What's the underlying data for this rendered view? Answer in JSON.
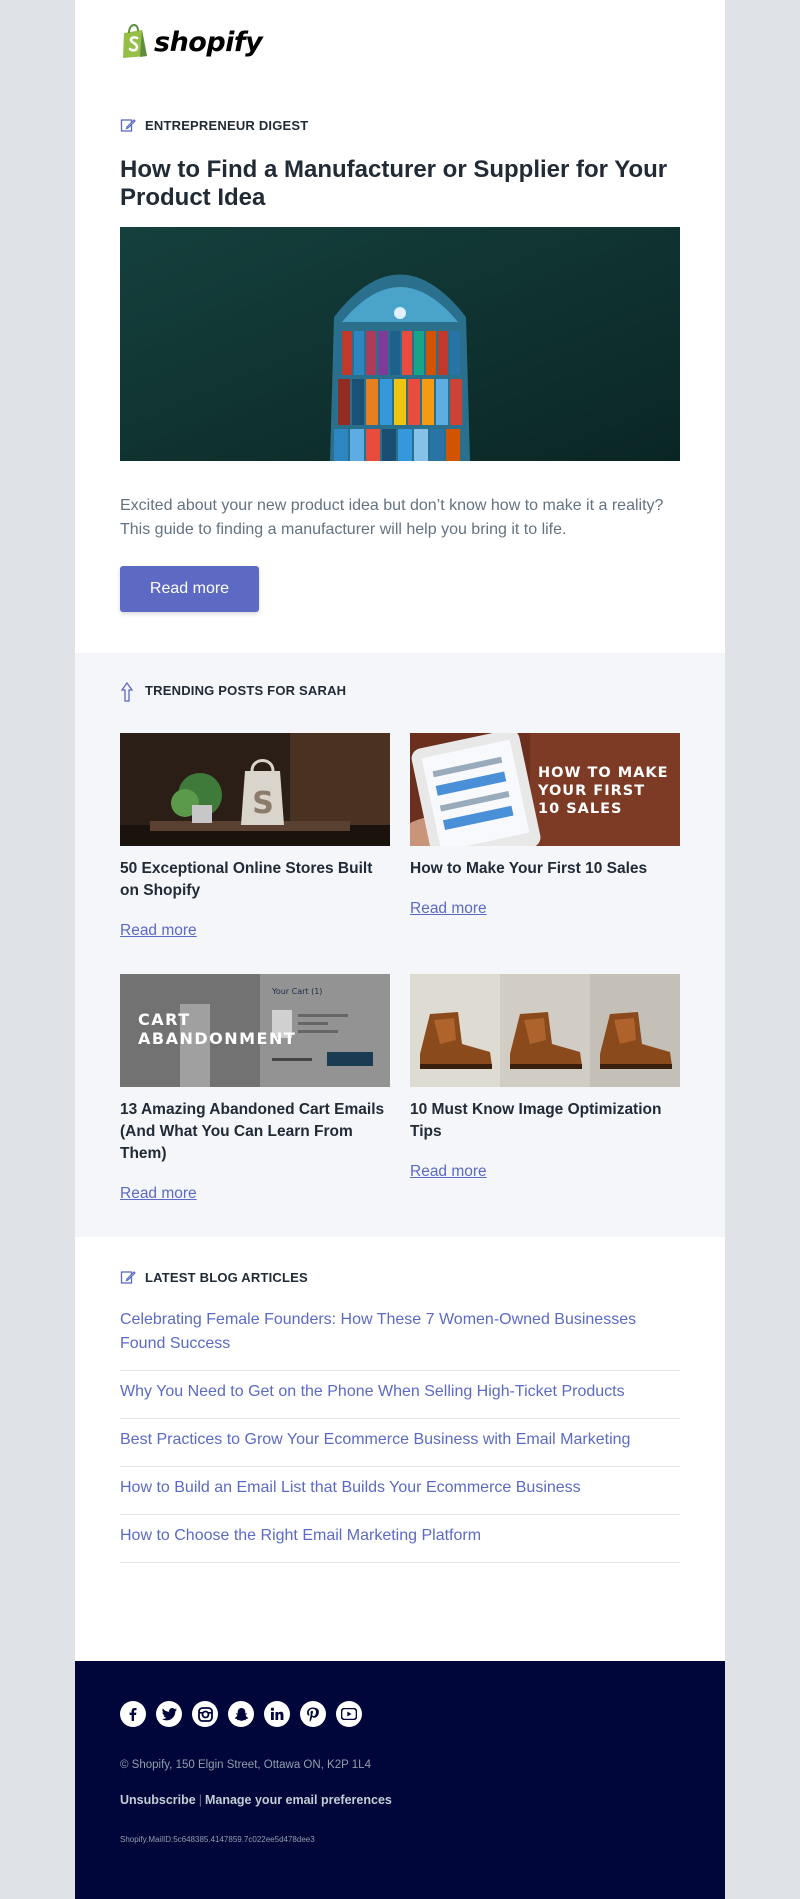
{
  "brand": {
    "wordmark": "shopify",
    "logo_icon": "shopify-bag-icon",
    "accent": "#5c6ac4",
    "logo_green": "#95bf47"
  },
  "hero": {
    "section_label": "ENTREPRENEUR DIGEST",
    "section_icon": "edit-note-icon",
    "title": "How to Find a Manufacturer or Supplier for Your Product Idea",
    "image": "cargo-ship-aerial-image",
    "body": "Excited about your new product idea but don’t know how to make it a reality? This guide to finding a manufacturer will help you bring it to life.",
    "button_label": "Read more"
  },
  "trending": {
    "section_label": "TRENDING POSTS FOR SARAH",
    "section_icon": "trending-arrow-icon",
    "cards": [
      {
        "title": "50 Exceptional Online Stores Built on Shopify",
        "link": "Read more",
        "image": "shopify-bag-plant-image"
      },
      {
        "title": "How to Make Your First 10 Sales",
        "link": "Read more",
        "image": "phone-in-hand-image",
        "overlay": "HOW TO MAKE YOUR FIRST 10 SALES"
      },
      {
        "title": "13 Amazing Abandoned Cart Emails (And What You Can Learn From Them)",
        "link": "Read more",
        "image": "cart-screen-image",
        "overlay": "CART ABANDONMENT",
        "screen_label": "Your Cart (1)"
      },
      {
        "title": "10 Must Know Image Optimization Tips",
        "link": "Read more",
        "image": "leather-boots-image"
      }
    ]
  },
  "latest": {
    "section_label": "LATEST BLOG ARTICLES",
    "section_icon": "edit-note-icon",
    "items": [
      "Celebrating Female Founders: How These 7 Women-Owned Businesses Found Success",
      "Why You Need to Get on the Phone When Selling High-Ticket Products",
      "Best Practices to Grow Your Ecommerce Business with Email Marketing",
      "How to Build an Email List that Builds Your Ecommerce Business",
      "How to Choose the Right Email Marketing Platform"
    ]
  },
  "footer": {
    "socials": [
      "facebook-icon",
      "twitter-icon",
      "instagram-icon",
      "snapchat-icon",
      "linkedin-icon",
      "pinterest-icon",
      "youtube-icon"
    ],
    "address": "© Shopify,  150 Elgin Street, Ottawa ON, K2P 1L4",
    "unsubscribe": "Unsubscribe",
    "separator": "|",
    "manage": "Manage your email preferences",
    "mail_id": "Shopify.MailID:5c648385.4147859.7c022ee5d478dee3"
  }
}
